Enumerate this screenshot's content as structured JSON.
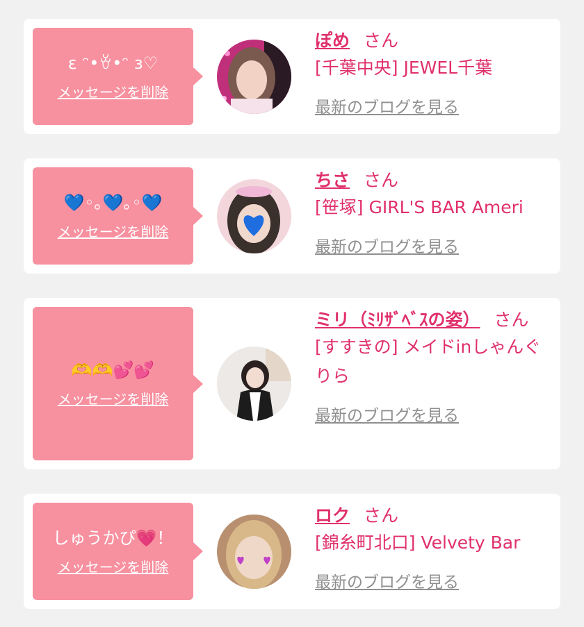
{
  "cards": [
    {
      "message": "ε ᵔ•ꈊ•ᵔ ɜ♡",
      "delete_label": "メッセージを削除",
      "name": "ぽめ",
      "honorific": "さん",
      "shop": "[千葉中央] JEWEL千葉",
      "blog_label": "最新のブログを見る"
    },
    {
      "message": "💙◦｡💙｡◦💙",
      "delete_label": "メッセージを削除",
      "name": "ちさ",
      "honorific": "さん",
      "shop": "[笹塚] GIRL'S BAR Ameri",
      "blog_label": "最新のブログを見る"
    },
    {
      "message": "🫶🫶💕💕",
      "delete_label": "メッセージを削除",
      "name": "ミリ（ﾐﾘｻﾞﾍﾞｽの姿）",
      "honorific": "さん",
      "shop": "[すすきの] メイドinしゃんぐりら",
      "blog_label": "最新のブログを見る"
    },
    {
      "message": "しゅうかぴ💗！",
      "delete_label": "メッセージを削除",
      "name": "ロク",
      "honorific": "さん",
      "shop": "[錦糸町北口] Velvety Bar",
      "blog_label": "最新のブログを見る"
    }
  ]
}
